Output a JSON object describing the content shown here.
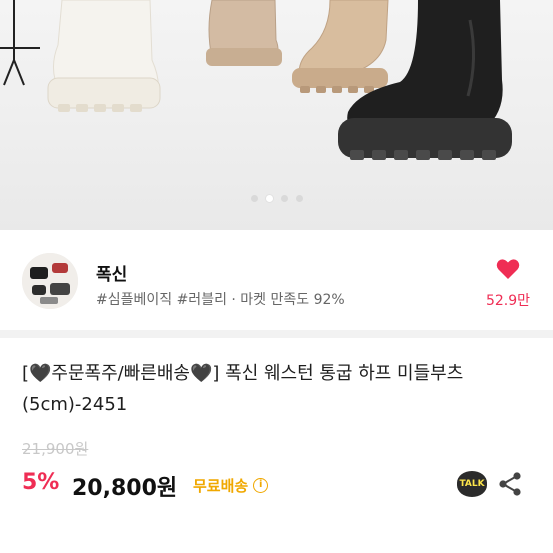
{
  "hero": {
    "image_alt": "boots product photo",
    "pagination": {
      "count": 4,
      "active": 2
    }
  },
  "shop": {
    "name": "폭신",
    "meta": "#심플베이직 #러블리 · 마켓 만족도 92%",
    "likes": "52.9만",
    "heart_color": "#ef2d54"
  },
  "product": {
    "title": "[🖤주문폭주/빠른배송🖤] 폭신 웨스턴 통굽 하프 미들부츠 (5cm)-2451",
    "original_price": "21,900원",
    "discount": "5%",
    "price": "20,800원",
    "shipping": "무료배송",
    "talk_label": "TALK"
  },
  "colors": {
    "accent": "#ef2d54",
    "shipping": "#f0a800"
  }
}
